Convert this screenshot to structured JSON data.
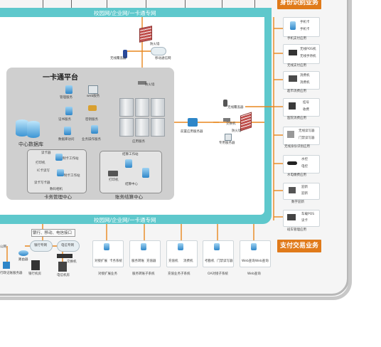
{
  "network_band_top": "校园网/企业网/一卡通专网",
  "network_band_bottom": "校园网/企业网/一卡通专网",
  "platform_title": "一卡通平台",
  "center_db": "中心数据库",
  "services": {
    "management": "管理服务",
    "web": "web服务",
    "certificate": "证书服务",
    "key": "密钥服务",
    "app": "应用服务",
    "db_access": "数据库访问",
    "business_op": "业务操作服务"
  },
  "card_center": {
    "title": "卡务管理中心",
    "items": [
      "读卡器",
      "打印机",
      "IC卡读写",
      "读卡写卡器",
      "制卡工作站",
      "制卡工作站",
      "数码相机"
    ]
  },
  "settlement_center": {
    "title": "账务结算中心",
    "items": [
      "结算工作站",
      "打印机",
      "结算中心"
    ]
  },
  "top_devices": {
    "firewall": "防火墙",
    "wireless_ap": "无线覆盖器",
    "mobile": "移动通信网",
    "fw2_label": "防火墙"
  },
  "mid_devices": {
    "fep": "前置应用服务器",
    "firewall": "防火墙",
    "ap": "无线覆盖器",
    "server": "专用服务器",
    "switch": "交换机"
  },
  "right_header": "身份识别业务",
  "right_items": [
    {
      "label": "手机支付应用",
      "lines": [
        "手机卡",
        "手机卡"
      ]
    },
    {
      "label": "无线支付应用",
      "lines": [
        "无线POS机",
        "无线手持机"
      ]
    },
    {
      "label": "超市消费应用",
      "lines": [
        "消费机",
        "消费机"
      ]
    },
    {
      "label": "医院消费应用",
      "lines": [
        "挂号",
        "收费"
      ]
    },
    {
      "label": "无线身份识别应用",
      "lines": [
        "无线读写器",
        "门禁读写器"
      ]
    },
    {
      "label": "水电缴费应用",
      "lines": [
        "水控",
        "电控"
      ]
    },
    {
      "label": "数字迎新",
      "lines": [
        "迎新",
        "迎新"
      ]
    },
    {
      "label": "班车管理应用",
      "lines": [
        "车载POS",
        "读卡"
      ]
    }
  ],
  "right_footer": "支付交易业务",
  "bank_bar": "银行、移动、电信接口",
  "bottom_left": {
    "router": "路由器",
    "bank_net": "银行专网",
    "telecom_net": "电信专网",
    "switch": "交换机",
    "pc_label": "行政记账服务器",
    "bank_machine": "银行机房",
    "telecom_machine": "电信机房",
    "bank_net_label": "公网"
  },
  "bottom_systems": [
    {
      "label": "对接扩展业务",
      "inner": [
        "对接扩展",
        "卡务系统"
      ]
    },
    {
      "label": "服务转账子系统",
      "inner": [
        "服务转账",
        "充值器"
      ]
    },
    {
      "label": "充值业务子系统",
      "inner": [
        "充值机",
        "消费机"
      ]
    },
    {
      "label": "OA对接子系统",
      "inner": [
        "考勤机",
        "门禁读写器"
      ]
    },
    {
      "label": "Web查询",
      "inner": [
        "Web查询",
        "Web查询"
      ]
    }
  ],
  "colors": {
    "teal": "#5ec8cc",
    "orange": "#e07a1a",
    "line_orange": "#e8871e",
    "platform_gray": "#cfcfcf"
  }
}
